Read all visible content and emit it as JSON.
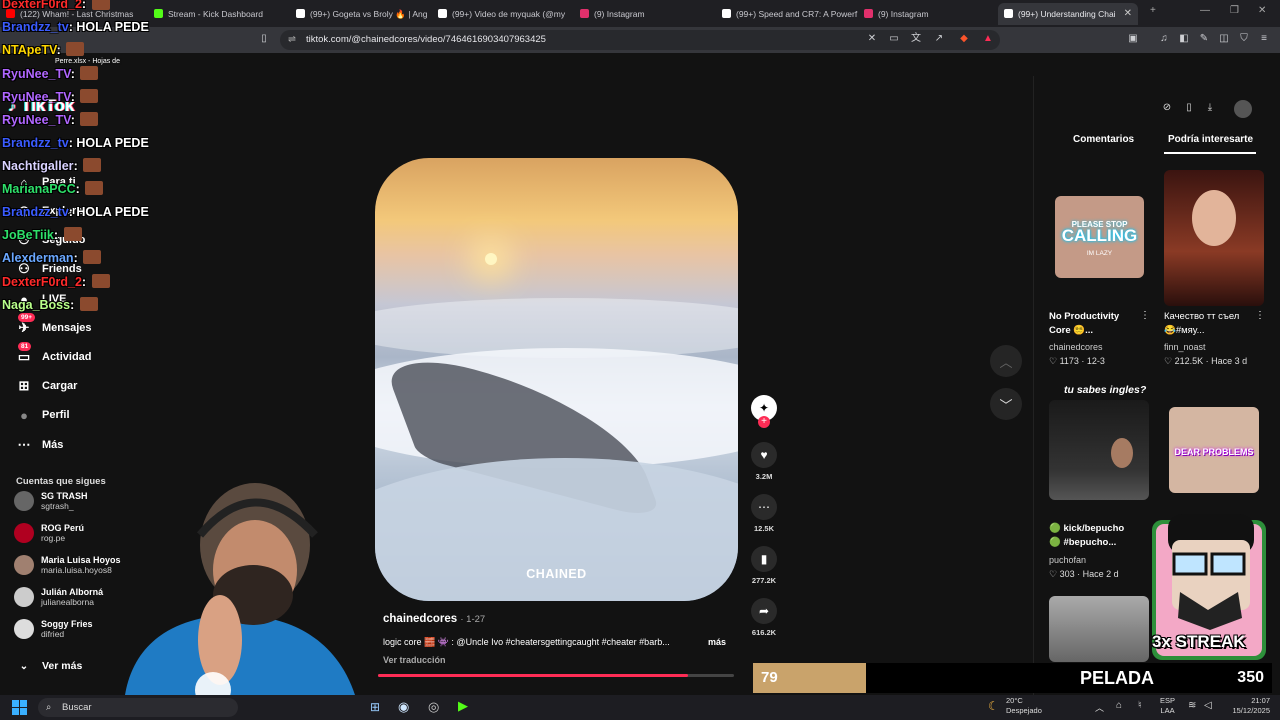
{
  "browser": {
    "tabs": [
      {
        "title": "(122) Wham! - Last Christmas",
        "color": "#ff0000"
      },
      {
        "title": "Stream - Kick Dashboard",
        "color": "#53fc18"
      },
      {
        "title": "(99+) Gogeta vs Broly 🔥 | Ang",
        "color": "#ffffff"
      },
      {
        "title": "(99+) Video de myquak (@my",
        "color": "#ffffff"
      },
      {
        "title": "(9) Instagram",
        "color": "#e1306c"
      },
      {
        "title": "(99+) Speed and CR7: A Powerf",
        "color": "#ffffff"
      },
      {
        "title": "(9) Instagram",
        "color": "#e1306c"
      },
      {
        "title": "(99+) Understanding Chai",
        "color": "#ffffff"
      }
    ],
    "url": "tiktok.com/@chainedcores/video/7464616903407963425"
  },
  "chat": {
    "lines": [
      {
        "user": "DexterF0rd_2",
        "color": "#ff2a2a",
        "text": ""
      },
      {
        "user": "Brandzz_tv",
        "color": "#3b5cff",
        "text": "HOLA PEDE"
      },
      {
        "user": "NTApeTV",
        "color": "#ffd700",
        "text": ""
      },
      {
        "user": "RyuNee_TV",
        "color": "#b066ff",
        "text": ""
      },
      {
        "user": "RyuNee_TV",
        "color": "#b066ff",
        "text": ""
      },
      {
        "user": "RyuNee_TV",
        "color": "#b066ff",
        "text": ""
      },
      {
        "user": "Brandzz_tv",
        "color": "#3b5cff",
        "text": "HOLA PEDE"
      },
      {
        "user": "Nachtigaller",
        "color": "#d9d2ff",
        "text": ""
      },
      {
        "user": "MarianaPCC",
        "color": "#2ee06a",
        "text": ""
      },
      {
        "user": "Brandzz_tv",
        "color": "#3b5cff",
        "text": "HOLA PEDE"
      },
      {
        "user": "JoBeTiik",
        "color": "#2ee06a",
        "text": ""
      },
      {
        "user": "Alexderman",
        "color": "#6aa7ff",
        "text": ""
      },
      {
        "user": "DexterF0rd_2",
        "color": "#ff2a2a",
        "text": ""
      },
      {
        "user": "Naga_Boss",
        "color": "#b8ff8a",
        "text": ""
      }
    ],
    "excel_popup": "Perre.xlsx - Hojas de"
  },
  "tiktok": {
    "logo": "TikTok",
    "nav": [
      {
        "label": "Para ti",
        "icon": "home-icon"
      },
      {
        "label": "Explorar",
        "icon": "compass-icon"
      },
      {
        "label": "Seguido",
        "icon": "following-icon"
      },
      {
        "label": "Friends",
        "icon": "friends-icon"
      },
      {
        "label": "LIVE",
        "icon": "live-icon"
      },
      {
        "label": "Mensajes",
        "icon": "messages-icon",
        "badge": "99+"
      },
      {
        "label": "Actividad",
        "icon": "activity-icon",
        "badge": "81"
      },
      {
        "label": "Cargar",
        "icon": "upload-icon"
      },
      {
        "label": "Perfil",
        "icon": "profile-icon"
      },
      {
        "label": "Más",
        "icon": "more-icon"
      }
    ],
    "following_heading": "Cuentas que sigues",
    "following": [
      {
        "name": "SG TRASH",
        "handle": "sgtrash_",
        "color": "#666"
      },
      {
        "name": "ROG Perú",
        "handle": "rog.pe",
        "color": "#b00020",
        "verified": true
      },
      {
        "name": "Maria Luisa Hoyos",
        "handle": "maria.luisa.hoyos8",
        "color": "#a08070"
      },
      {
        "name": "Julián Alborná",
        "handle": "julianealborna",
        "color": "#ccc"
      },
      {
        "name": "Soggy Fries",
        "handle": "difried",
        "color": "#ddd"
      }
    ],
    "see_more": "Ver más",
    "video": {
      "watermark": "CHAINED",
      "author": "chainedcores",
      "date": "1-27",
      "description": "logic core 🧱 👾 : @Uncle Ivo #cheatersgettingcaught #cheater #barb...",
      "more": "más",
      "translate": "Ver traducción",
      "progress": 0.87
    },
    "actions": [
      {
        "icon": "heart-icon",
        "count": "3.2M"
      },
      {
        "icon": "comment-icon",
        "count": "12.5K"
      },
      {
        "icon": "bookmark-icon",
        "count": "277.2K"
      },
      {
        "icon": "share-icon",
        "count": "616.2K"
      }
    ],
    "right_tabs": {
      "comments": "Comentarios",
      "suggested": "Podría interesarte"
    },
    "suggested": [
      {
        "title_line1": "No Productivity",
        "title_line2": "Core 😵‍💫...",
        "user": "chainedcores",
        "stats": "♡ 1173 · 12-3",
        "thumb_text": "CALLING",
        "thumb_text2": "PLEASE STOP",
        "thumb_text3": "IM LAZY"
      },
      {
        "title_line1": "Качество тт съел",
        "title_line2": "😂#мяу...",
        "user": "finn_noast",
        "stats": "♡ 212.5K · Hace 3 d"
      },
      {
        "title_line1": "tu sabes ingles?",
        "title_line2": "",
        "user": "",
        "stats": ""
      },
      {
        "title_line1": "",
        "title_line2": "",
        "user": "",
        "stats": "",
        "thumb_text": "DEAR PROBLEMS"
      },
      {
        "title_line1": "🟢 kick/bepucho",
        "title_line2": "🟢 #bepucho...",
        "user": "puchofan",
        "stats": "♡ 303 · Hace 2 d"
      }
    ]
  },
  "stream_overlay": {
    "number": "79",
    "title": "PELADA",
    "score": "350",
    "streak": "3x STREAK"
  },
  "taskbar": {
    "search": "Buscar",
    "weather_temp": "20°C",
    "weather_desc": "Despejado",
    "lang": "ESP",
    "lang2": "LAA",
    "time": "21:07",
    "date": "15/12/2025"
  }
}
